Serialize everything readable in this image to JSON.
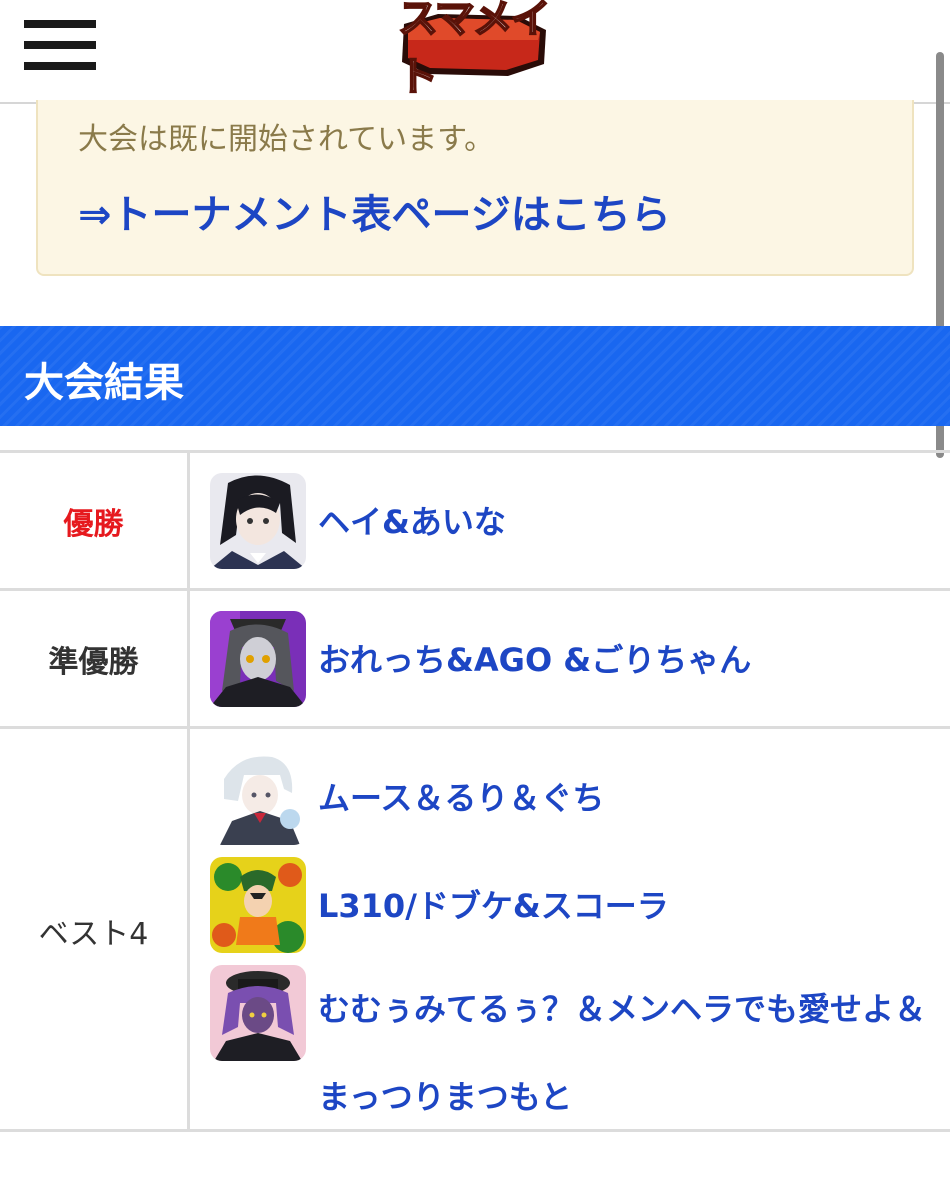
{
  "header": {
    "logo_text": "スマメイト",
    "menu_icon": "hamburger-menu-icon"
  },
  "notice": {
    "text": "大会は既に開始されています。",
    "link": "⇒トーナメント表ページはこちら"
  },
  "section": {
    "title": "大会結果"
  },
  "results": [
    {
      "rank": "優勝",
      "teams": [
        "ヘイ&あいな"
      ]
    },
    {
      "rank": "準優勝",
      "teams": [
        "おれっち&AGO &ごりちゃん"
      ]
    },
    {
      "rank": "ベスト4",
      "teams": [
        "ムース＆るり＆ぐち",
        "L310/ドブケ&スコーラ",
        "むむぅみてるぅ？＆メンヘラでも愛せよ＆まっつりまつもと"
      ]
    }
  ],
  "colors": {
    "accent_blue": "#1967f0",
    "link_blue": "#1d46c4",
    "winner_red": "#e6191e",
    "notice_bg": "#fcf6e4"
  }
}
